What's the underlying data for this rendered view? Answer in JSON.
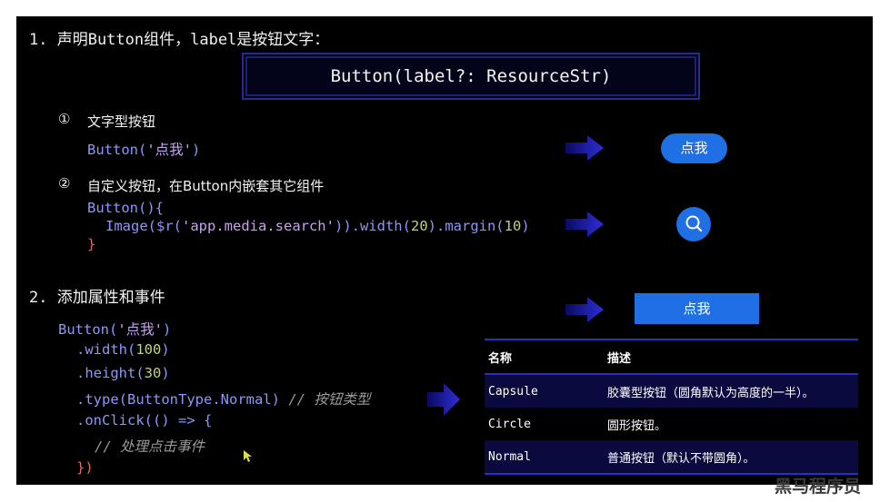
{
  "slide": {
    "heading1": "1. 声明Button组件，label是按钮文字：",
    "signature": "Button(label?: ResourceStr)",
    "item1": {
      "num": "①",
      "title": "文字型按钮"
    },
    "item2": {
      "num": "②",
      "title": "自定义按钮，在Button内嵌套其它组件"
    },
    "heading2": "2. 添加属性和事件",
    "code1": {
      "fn": "Button(",
      "str": "'点我'",
      "close": ")"
    },
    "code2": {
      "line1": "Button(){",
      "l2_a": "Image(",
      "l2_b": "$r(",
      "l2_c": "'app.media.search'",
      "l2_d": ")).width(",
      "l2_e": "20",
      "l2_f": ").margin(",
      "l2_g": "10",
      "l2_h": ")",
      "line3": "}"
    },
    "code3": {
      "l1_a": "Button(",
      "l1_b": "'点我'",
      "l1_c": ")",
      "l2_a": ".width(",
      "l2_b": "100",
      "l2_c": ")",
      "l3_a": ".height(",
      "l3_b": "30",
      "l3_c": ")",
      "l4_a": ".type(",
      "l4_b": "ButtonType.Normal",
      "l4_c": ")",
      "l4_cm": "// 按钮类型",
      "l5_a": ".onClick(",
      "l5_b": "() => {",
      "l6": "// 处理点击事件",
      "l7": "})"
    },
    "demo_capsule_label": "点我",
    "demo_normal_label": "点我",
    "table": {
      "headers": [
        "名称",
        "描述"
      ],
      "rows": [
        [
          "Capsule",
          "胶囊型按钮（圆角默认为高度的一半）。"
        ],
        [
          "Circle",
          "圆形按钮。"
        ],
        [
          "Normal",
          "普通按钮（默认不带圆角）。"
        ]
      ]
    },
    "watermark": "黑马程序员"
  },
  "colors": {
    "button_blue": "#1f6fe5",
    "keyword": "#8f96f6",
    "string": "#c6a3ef",
    "number": "#b9d57c",
    "table_accent": "#2a2fbf"
  }
}
